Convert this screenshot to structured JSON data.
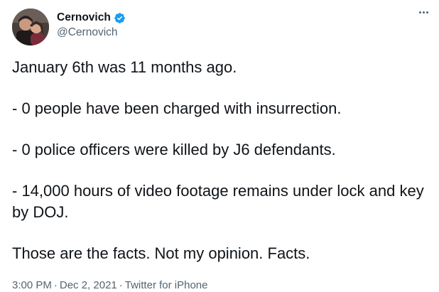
{
  "tweet": {
    "author": {
      "display_name": "Cernovich",
      "handle": "@Cernovich",
      "verified": true
    },
    "paragraphs": [
      "January 6th was 11 months ago.",
      "- 0 people have been charged with insurrection.",
      "- 0 police officers were killed by J6 defendants.",
      "- 14,000 hours of video footage remains under lock and key by DOJ.",
      "Those are the facts. Not my opinion. Facts."
    ],
    "meta": {
      "time": "3:00 PM",
      "separator": "·",
      "date": "Dec 2, 2021",
      "source": "Twitter for iPhone"
    }
  },
  "icons": {
    "verified": "verified-badge-icon",
    "more": "more-options-icon"
  },
  "colors": {
    "text": "#0f1419",
    "secondary": "#536471",
    "verified": "#1d9bf0"
  }
}
